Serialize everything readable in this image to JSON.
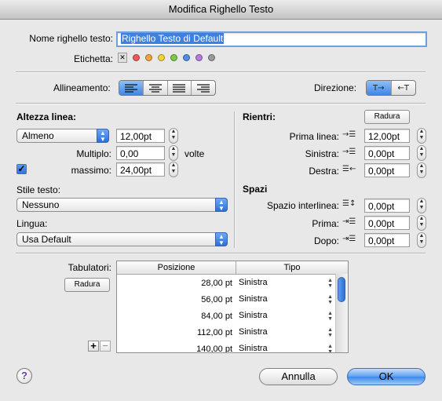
{
  "window": {
    "title": "Modifica Righello Testo"
  },
  "name_row": {
    "label": "Nome righello testo:",
    "value": "Righello Testo di Default"
  },
  "tag_row": {
    "label": "Etichetta:",
    "none_glyph": "✕",
    "colors": [
      "#ee5a5a",
      "#f3a23a",
      "#f2d43a",
      "#7cc84a",
      "#4f8fe8",
      "#b57ae0",
      "#9a9a9a"
    ]
  },
  "alignment": {
    "label": "Allineamento:",
    "icons": [
      "align-left-icon",
      "align-center-icon",
      "align-justify-icon",
      "align-right-icon"
    ],
    "selected_index": 0
  },
  "direction": {
    "label": "Direzione:",
    "options": [
      "T→",
      "←T"
    ],
    "selected_index": 0
  },
  "line_height": {
    "section_label": "Altezza linea:",
    "mode": "Almeno",
    "value": "12,00pt",
    "multiple_label": "Multiplo:",
    "multiple_value": "0,00",
    "multiple_unit": "volte",
    "max_label": "massimo:",
    "max_checked": true,
    "max_value": "24,00pt"
  },
  "text_style": {
    "label": "Stile testo:",
    "value": "Nessuno"
  },
  "language": {
    "label": "Lingua:",
    "value": "Usa Default"
  },
  "indents": {
    "section_label": "Rientri:",
    "reset_label": "Radura",
    "first_line": {
      "label": "Prima linea:",
      "value": "12,00pt"
    },
    "left": {
      "label": "Sinistra:",
      "value": "0,00pt"
    },
    "right": {
      "label": "Destra:",
      "value": "0,00pt"
    }
  },
  "spacing": {
    "section_label": "Spazi",
    "line_spacing": {
      "label": "Spazio interlinea:",
      "value": "0,00pt"
    },
    "before": {
      "label": "Prima:",
      "value": "0,00pt"
    },
    "after": {
      "label": "Dopo:",
      "value": "0,00pt"
    }
  },
  "tabs": {
    "label": "Tabulatori:",
    "reset_label": "Radura",
    "add_label": "+",
    "remove_label": "−",
    "columns": [
      "Posizione",
      "Tipo"
    ],
    "rows": [
      {
        "position": "28,00 pt",
        "type": "Sinistra"
      },
      {
        "position": "56,00 pt",
        "type": "Sinistra"
      },
      {
        "position": "84,00 pt",
        "type": "Sinistra"
      },
      {
        "position": "112,00 pt",
        "type": "Sinistra"
      },
      {
        "position": "140,00 pt",
        "type": "Sinistra"
      }
    ]
  },
  "footer": {
    "help_label": "?",
    "cancel_label": "Annulla",
    "ok_label": "OK"
  }
}
